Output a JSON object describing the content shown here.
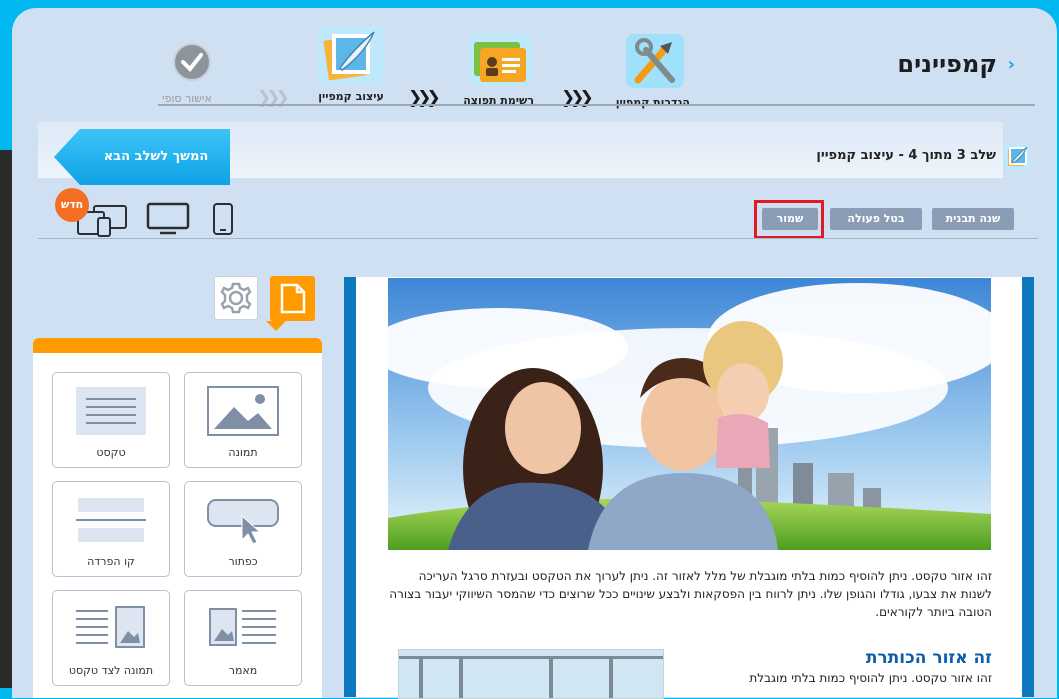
{
  "header": {
    "title": "קמפיינים",
    "steps": [
      {
        "label": "הגדרות קמפיין",
        "icon": "tools-icon"
      },
      {
        "label": "רשימת תפוצה",
        "icon": "contact-cards-icon"
      },
      {
        "label": "עיצוב קמפיין",
        "icon": "design-feather-icon"
      },
      {
        "label": "אישור סופי",
        "icon": "check-circle-icon"
      }
    ]
  },
  "step_bar": {
    "text": "שלב 3 מתוך 4 - עיצוב קמפיין",
    "next_label": "המשך לשלב הבא"
  },
  "toolbar": {
    "change_template": "שנה תבנית",
    "undo": "בטל פעולה",
    "save": "שמור",
    "new_badge": "חדש",
    "devices": [
      "mobile-icon",
      "desktop-icon",
      "multi-device-icon"
    ]
  },
  "sidebar": {
    "tools": [
      {
        "label": "תמונה",
        "icon": "image-icon"
      },
      {
        "label": "טקסט",
        "icon": "text-icon"
      },
      {
        "label": "כפתור",
        "icon": "button-icon"
      },
      {
        "label": "קו הפרדה",
        "icon": "divider-icon"
      },
      {
        "label": "מאמר",
        "icon": "article-icon"
      },
      {
        "label": "תמונה לצד טקסט",
        "icon": "image-beside-text-icon"
      }
    ]
  },
  "content": {
    "paragraph": "זהו אזור טקסט. ניתן להוסיף כמות בלתי מוגבלת של מלל לאזור זה. ניתן לערוך את הטקסט ובעזרת סרגל העריכה לשנות את צבעו, גודלו והגופן שלו. ניתן לרווח בין הפסקאות ולבצע שינויים ככל שרוצים כדי שהמסר השיווקי יעבור בצורה הטובה ביותר לקוראים.",
    "heading": "זה אזור הכותרת",
    "paragraph2": "זהו אזור טקסט. ניתן להוסיף כמות בלתי מוגבלת"
  },
  "colors": {
    "accent_blue": "#0e79c1",
    "orange": "#ff9a00",
    "highlight_red": "#e11a24",
    "button_gray": "#8a9db5"
  }
}
